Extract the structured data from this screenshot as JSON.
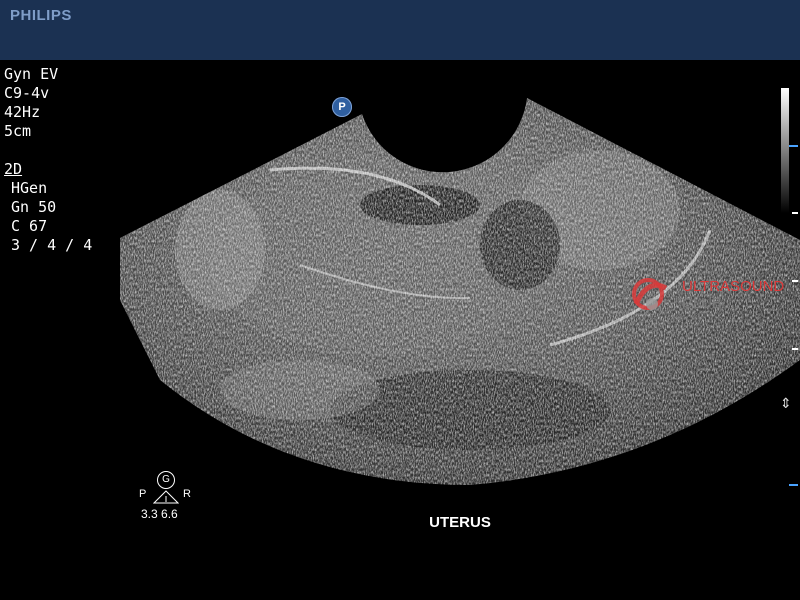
{
  "header": {
    "brand": "PHILIPS"
  },
  "params": {
    "preset": "Gyn EV",
    "probe": "C9-4v",
    "frame_rate": "42Hz",
    "depth": "5cm",
    "mode": "2D",
    "harmonic": "HGen",
    "gain": "Gn 50",
    "compression": "C 67",
    "persistence": "3 / 4 / 4"
  },
  "marker": {
    "label": "P"
  },
  "watermark": {
    "line1": "ULTRASOUND",
    "line2": "CLUB"
  },
  "orientation": {
    "badge": "G",
    "left": "P",
    "right": "R",
    "values": "3.3  6.6"
  },
  "image_label": "UTERUS",
  "colors": {
    "topbar": "#1b3152",
    "brand": "#7f9dc8",
    "accent_blue": "#4aa3ff",
    "watermark_red": "#d93a3a"
  }
}
